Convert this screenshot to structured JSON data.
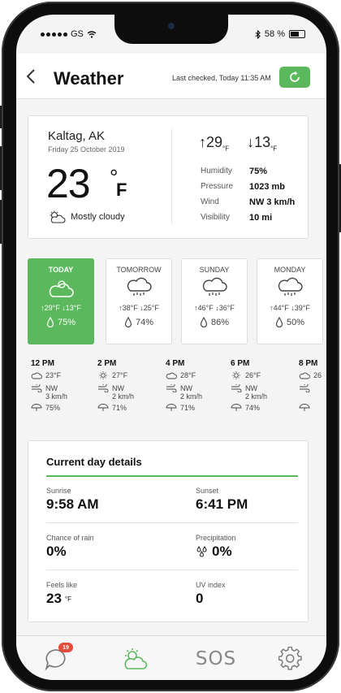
{
  "status_bar": {
    "carrier": "GS",
    "battery": "58 %"
  },
  "header": {
    "back_icon": "chevron-left-icon",
    "title": "Weather",
    "last_checked": "Last checked, Today 11:35 AM",
    "refresh_icon": "refresh-icon"
  },
  "current": {
    "city": "Kaltag, AK",
    "date": "Friday 25 October 2019",
    "temp": "23",
    "degree": "°",
    "unit": "F",
    "condition": "Mostly cloudy",
    "condition_icon": "partly-cloudy-icon",
    "high": "29",
    "low": "13",
    "high_unit": "°F",
    "low_unit": "°F",
    "stats": [
      {
        "label": "Humidity",
        "value": "75%"
      },
      {
        "label": "Pressure",
        "value": "1023 mb"
      },
      {
        "label": "Wind",
        "value": "NW 3 km/h"
      },
      {
        "label": "Visibility",
        "value": "10 mi"
      }
    ]
  },
  "forecast": [
    {
      "label": "TODAY",
      "icon": "cloud-icon",
      "high": "↑29°F",
      "low": "↓13°F",
      "rain": "75%",
      "active": true
    },
    {
      "label": "TOMORROW",
      "icon": "rain-cloud-icon",
      "high": "↑38°F",
      "low": "↓25°F",
      "rain": "74%",
      "active": false
    },
    {
      "label": "SUNDAY",
      "icon": "rain-cloud-icon",
      "high": "↑46°F",
      "low": "↓36°F",
      "rain": "86%",
      "active": false
    },
    {
      "label": "MONDAY",
      "icon": "rain-cloud-icon",
      "high": "↑44°F",
      "low": "↓39°F",
      "rain": "50%",
      "active": false
    }
  ],
  "hourly": [
    {
      "time": "12 PM",
      "icon": "cloud-icon",
      "temp": "23°F",
      "wind_dir": "NW",
      "wind_speed": "3 km/h",
      "rain": "75%"
    },
    {
      "time": "2 PM",
      "icon": "sun-icon",
      "temp": "27°F",
      "wind_dir": "NW",
      "wind_speed": "2 km/h",
      "rain": "71%"
    },
    {
      "time": "4 PM",
      "icon": "cloud-icon",
      "temp": "28°F",
      "wind_dir": "NW",
      "wind_speed": "2 km/h",
      "rain": "71%"
    },
    {
      "time": "6 PM",
      "icon": "sun-icon",
      "temp": "26°F",
      "wind_dir": "NW",
      "wind_speed": "2 km/h",
      "rain": "74%"
    },
    {
      "time": "8 PM",
      "icon": "cloud-icon",
      "temp": "26",
      "wind_dir": "",
      "wind_speed": "",
      "rain": ""
    }
  ],
  "details": {
    "title": "Current day details",
    "sunrise_label": "Sunrise",
    "sunrise": "9:58 AM",
    "sunset_label": "Sunset",
    "sunset": "6:41 PM",
    "rain_label": "Chance of rain",
    "rain": "0%",
    "precip_label": "Precipitation",
    "precip": "0%",
    "feels_label": "Feels like",
    "feels": "23",
    "feels_unit": "°F",
    "uv_label": "UV index",
    "uv": "0"
  },
  "tabbar": {
    "messages_badge": "19",
    "sos_label": "SOS",
    "icons": [
      "chat-icon",
      "weather-icon",
      "sos-icon",
      "settings-icon"
    ]
  },
  "colors": {
    "accent": "#5cb85c",
    "badge": "#e34b3a"
  }
}
